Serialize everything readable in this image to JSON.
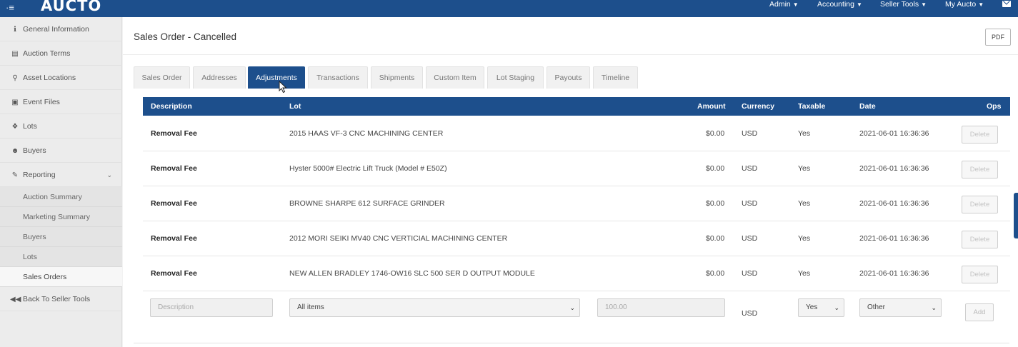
{
  "app": {
    "logo": "AUCTO",
    "menu": [
      {
        "label": "Admin"
      },
      {
        "label": "Accounting"
      },
      {
        "label": "Seller Tools"
      },
      {
        "label": "My Aucto"
      }
    ],
    "caret": "▼"
  },
  "sidebar": {
    "items": [
      {
        "label": "General Information",
        "icon": "info-icon"
      },
      {
        "label": "Auction Terms",
        "icon": "document-icon"
      },
      {
        "label": "Asset Locations",
        "icon": "map-marker-icon"
      },
      {
        "label": "Event Files",
        "icon": "image-icon"
      },
      {
        "label": "Lots",
        "icon": "cubes-icon"
      },
      {
        "label": "Buyers",
        "icon": "users-icon"
      },
      {
        "label": "Reporting",
        "icon": "pencil-icon"
      }
    ],
    "reporting_sub": [
      {
        "label": "Auction Summary"
      },
      {
        "label": "Marketing Summary"
      },
      {
        "label": "Buyers"
      },
      {
        "label": "Lots"
      },
      {
        "label": "Sales Orders"
      }
    ],
    "back": {
      "label": "Back To Seller Tools",
      "icon": "fast-backward-icon"
    }
  },
  "page": {
    "title": "Sales Order - Cancelled",
    "pdf_label": "PDF"
  },
  "tabs": [
    {
      "label": "Sales Order"
    },
    {
      "label": "Addresses"
    },
    {
      "label": "Adjustments"
    },
    {
      "label": "Transactions"
    },
    {
      "label": "Shipments"
    },
    {
      "label": "Custom Item"
    },
    {
      "label": "Lot Staging"
    },
    {
      "label": "Payouts"
    },
    {
      "label": "Timeline"
    }
  ],
  "active_tab": "Adjustments",
  "table": {
    "columns": {
      "description": "Description",
      "lot": "Lot",
      "amount": "Amount",
      "currency": "Currency",
      "taxable": "Taxable",
      "date": "Date",
      "ops": "Ops"
    },
    "rows": [
      {
        "description": "Removal Fee",
        "lot": "2015 HAAS VF-3 CNC MACHINING CENTER",
        "amount": "$0.00",
        "currency": "USD",
        "taxable": "Yes",
        "date": "2021-06-01 16:36:36",
        "op": "Delete"
      },
      {
        "description": "Removal Fee",
        "lot": "Hyster 5000# Electric Lift Truck (Model # E50Z)",
        "amount": "$0.00",
        "currency": "USD",
        "taxable": "Yes",
        "date": "2021-06-01 16:36:36",
        "op": "Delete"
      },
      {
        "description": "Removal Fee",
        "lot": "BROWNE SHARPE 612 SURFACE GRINDER",
        "amount": "$0.00",
        "currency": "USD",
        "taxable": "Yes",
        "date": "2021-06-01 16:36:36",
        "op": "Delete"
      },
      {
        "description": "Removal Fee",
        "lot": "2012 MORI SEIKI MV40 CNC VERTICIAL MACHINING CENTER",
        "amount": "$0.00",
        "currency": "USD",
        "taxable": "Yes",
        "date": "2021-06-01 16:36:36",
        "op": "Delete"
      },
      {
        "description": "Removal Fee",
        "lot": "NEW ALLEN BRADLEY 1746-OW16 SLC 500 SER D OUTPUT MODULE",
        "amount": "$0.00",
        "currency": "USD",
        "taxable": "Yes",
        "date": "2021-06-01 16:36:36",
        "op": "Delete"
      }
    ]
  },
  "add_form": {
    "description_placeholder": "Description",
    "lot_selected": "All items",
    "amount_placeholder": "100.00",
    "currency": "USD",
    "taxable_selected": "Yes",
    "type_selected": "Other",
    "add_label": "Add"
  },
  "colors": {
    "brand": "#1d4f8c"
  }
}
